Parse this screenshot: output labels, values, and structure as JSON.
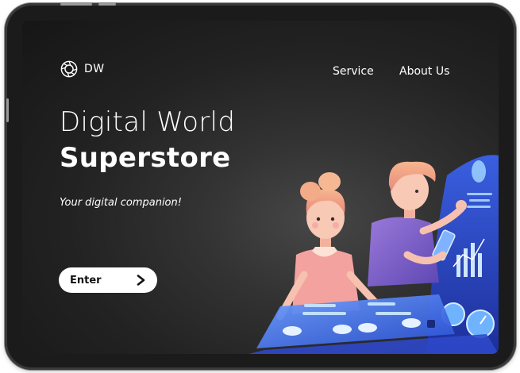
{
  "brand": {
    "logo_text": "DW",
    "logo_icon": "aperture-icon"
  },
  "nav": {
    "items": [
      {
        "label": "Service"
      },
      {
        "label": "About Us"
      }
    ]
  },
  "hero": {
    "title_line1": "Digital World",
    "title_line2": "Superstore",
    "tagline": "Your digital companion!",
    "cta_label": "Enter",
    "cta_icon": "chevron-right-icon"
  },
  "colors": {
    "screen_bg": "#1f1f1f",
    "text": "#ffffff",
    "accent_blue": "#3c66e0",
    "accent_pink": "#f3a2a0",
    "accent_purple": "#8a63c9"
  }
}
